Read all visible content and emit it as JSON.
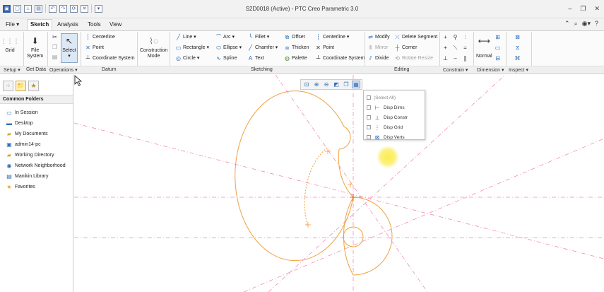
{
  "window": {
    "title": "S2D0018 (Active) - PTC Creo Parametric 3.0"
  },
  "menu_tabs": [
    {
      "label": "File ▾"
    },
    {
      "label": "Sketch",
      "active": true
    },
    {
      "label": "Analysis"
    },
    {
      "label": "Tools"
    },
    {
      "label": "View"
    }
  ],
  "ribbon": {
    "setup": {
      "grid": "Grid",
      "label": "Setup ▾"
    },
    "get_data": {
      "file_system": "File\nSystem",
      "label": "Get Data"
    },
    "operations": {
      "select": "Select",
      "label": "Operations ▾"
    },
    "datum": {
      "centerline": "Centerline",
      "point": "Point",
      "coordinate_system": "Coordinate System",
      "label": "Datum"
    },
    "construction_mode": {
      "label": "Construction\nMode"
    },
    "sketching": {
      "line": "Line ▾",
      "arc": "Arc ▾",
      "fillet": "Fillet ▾",
      "offset": "Offset",
      "centerline": "Centerline ▾",
      "rectangle": "Rectangle ▾",
      "ellipse": "Ellipse ▾",
      "chamfer": "Chamfer ▾",
      "thicken": "Thicken",
      "point": "Point",
      "circle": "Circle ▾",
      "spline": "Spline",
      "text": "Text",
      "palette": "Palette",
      "coordinate_system": "Coordinate System",
      "label": "Sketching"
    },
    "editing": {
      "modify": "Modify",
      "delete_segment": "Delete Segment",
      "mirror": "Mirror",
      "corner": "Corner",
      "divide": "Divide",
      "rotate_resize": "Rotate Resize",
      "label": "Editing"
    },
    "constrain": {
      "label": "Constrain ▾"
    },
    "dimension": {
      "normal": "Normal",
      "label": "Dimension ▾"
    },
    "inspect": {
      "label": "Inspect ▾"
    }
  },
  "left_panel": {
    "header": "Common Folders",
    "items": [
      {
        "label": "In Session",
        "icon": "monitor-icon"
      },
      {
        "label": "Desktop",
        "icon": "desktop-icon"
      },
      {
        "label": "My Documents",
        "icon": "folder-icon"
      },
      {
        "label": "admin14-pc",
        "icon": "computer-icon"
      },
      {
        "label": "Working Directory",
        "icon": "folder-star-icon"
      },
      {
        "label": "Network Neighborhood",
        "icon": "network-icon"
      },
      {
        "label": "Manikin Library",
        "icon": "manikin-icon"
      },
      {
        "label": "Favorites",
        "icon": "favorites-icon"
      }
    ]
  },
  "display_menu": {
    "items": [
      {
        "label": "(Select All)"
      },
      {
        "label": "Disp Dims"
      },
      {
        "label": "Disp Constr"
      },
      {
        "label": "Disp Grid"
      },
      {
        "label": "Disp Verts"
      }
    ]
  },
  "colors": {
    "sketch": "#f0a040",
    "construction": "#f28ab8",
    "cursor_highlight": "#f5e63c"
  }
}
